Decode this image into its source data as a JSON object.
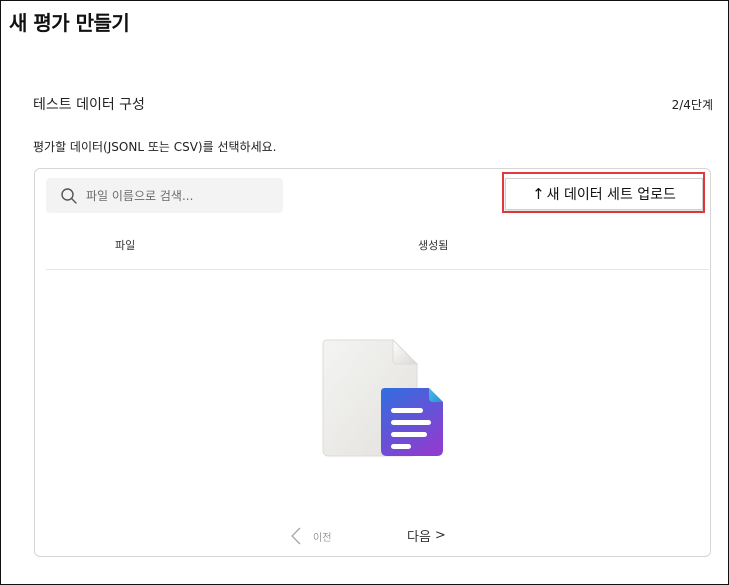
{
  "page": {
    "title": "새 평가 만들기"
  },
  "section": {
    "title": "테스트 데이터 구성",
    "step": "2/4단계",
    "instruction": "평가할 데이터(JSONL 또는 CSV)를 선택하세요."
  },
  "search": {
    "placeholder": "파일 이름으로 검색...",
    "value": "",
    "icon": "search-icon"
  },
  "toolbar": {
    "upload_arrow": "↑",
    "upload_label": "새 데이터 세트 업로드",
    "highlight_color": "#e0393e"
  },
  "table": {
    "columns": [
      "파일",
      "생성됨"
    ],
    "rows": []
  },
  "empty_state": {
    "icon": "document-file-icon",
    "accent_gradient": [
      "#2f6fe0",
      "#8a3fd0"
    ]
  },
  "pagination": {
    "prev_label": "이전",
    "next_label": "다음",
    "next_glyph": ">"
  }
}
